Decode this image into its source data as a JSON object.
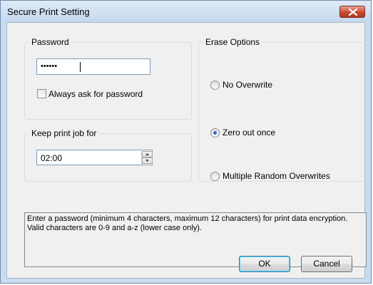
{
  "dialog": {
    "title": "Secure Print Setting"
  },
  "password_group": {
    "label": "Password",
    "value": "••••••",
    "always_ask_label": "Always ask for password",
    "always_ask_checked": false
  },
  "keep_group": {
    "label": "Keep print job for",
    "value": "02:00"
  },
  "erase_group": {
    "label": "Erase Options",
    "options": [
      {
        "label": "No Overwrite",
        "checked": false
      },
      {
        "label": "Zero out once",
        "checked": true
      },
      {
        "label": "Multiple Random Overwrites",
        "checked": false
      }
    ]
  },
  "message": {
    "line1": "Enter a password (minimum 4 characters, maximum 12 characters) for print data encryption.",
    "line2": "Valid characters are 0-9 and a-z (lower case only)."
  },
  "buttons": {
    "ok": "OK",
    "cancel": "Cancel"
  },
  "icons": {
    "close": "close-icon",
    "spin_up": "spin-up-icon",
    "spin_down": "spin-down-icon"
  }
}
